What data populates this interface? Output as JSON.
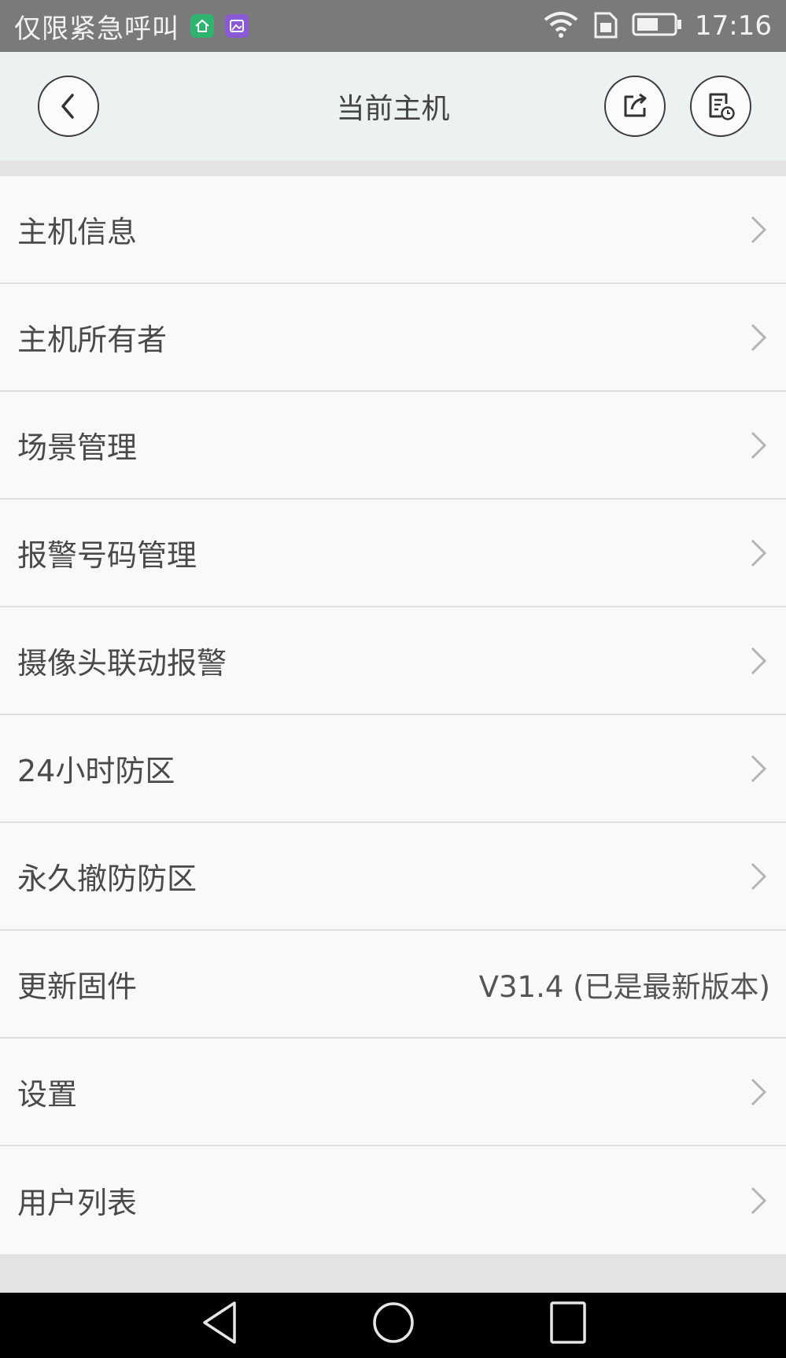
{
  "status_bar": {
    "carrier": "仅限紧急呼叫",
    "time": "17:16",
    "icons": [
      "home-app-icon",
      "gallery-app-icon",
      "wifi-icon",
      "sim-icon",
      "battery-icon"
    ]
  },
  "header": {
    "title": "当前主机",
    "background": "#ecf1f1",
    "buttons": [
      "back-icon",
      "share-icon",
      "record-icon"
    ]
  },
  "menu": {
    "items": [
      {
        "label": "主机信息",
        "value": ""
      },
      {
        "label": "主机所有者",
        "value": ""
      },
      {
        "label": "场景管理",
        "value": ""
      },
      {
        "label": "报警号码管理",
        "value": ""
      },
      {
        "label": "摄像头联动报警",
        "value": ""
      },
      {
        "label": "24小时防区",
        "value": ""
      },
      {
        "label": "永久撤防防区",
        "value": ""
      },
      {
        "label": "更新固件",
        "value": "V31.4 (已是最新版本)"
      },
      {
        "label": "设置",
        "value": ""
      },
      {
        "label": "用户列表",
        "value": ""
      }
    ]
  },
  "nav_bar": {
    "buttons": [
      "nav-back-icon",
      "nav-home-icon",
      "nav-recent-icon"
    ]
  }
}
